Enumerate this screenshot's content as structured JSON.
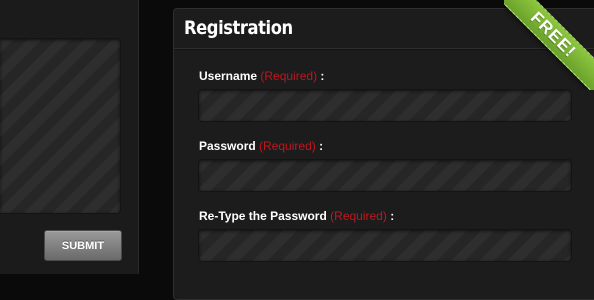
{
  "left_form": {
    "submit_label": "SUBMIT"
  },
  "registration": {
    "title": "Registration",
    "ribbon_label": "FREE!",
    "fields": [
      {
        "label": "Username",
        "required": "(Required)",
        "colon": ":",
        "value": ""
      },
      {
        "label": "Password",
        "required": "(Required)",
        "colon": ":",
        "value": ""
      },
      {
        "label": "Re-Type the Password",
        "required": "(Required)",
        "colon": ":",
        "value": ""
      }
    ]
  },
  "colors": {
    "background": "#0a0a0a",
    "panel": "#1c1c1c",
    "required_text": "#c0171f",
    "ribbon": "#7cb733",
    "button": "#888888"
  }
}
